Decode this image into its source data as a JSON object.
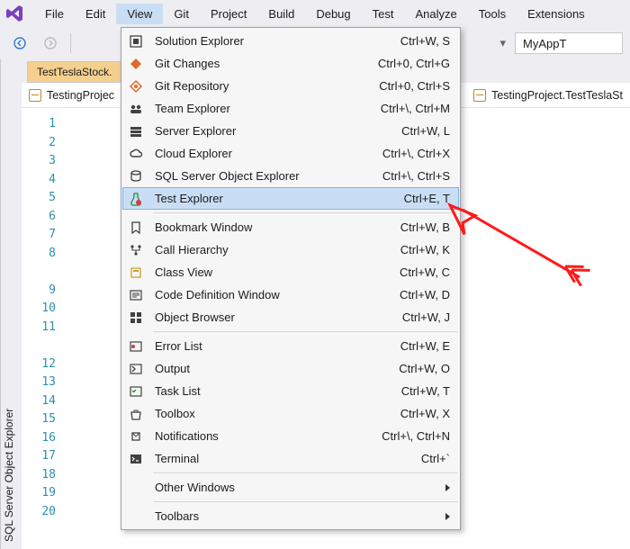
{
  "menubar": [
    "File",
    "Edit",
    "View",
    "Git",
    "Project",
    "Build",
    "Debug",
    "Test",
    "Analyze",
    "Tools",
    "Extensions"
  ],
  "menubar_active": 2,
  "toolbar": {
    "project_label": "MyAppT"
  },
  "side_tab": "SQL Server Object Explorer",
  "file_tab": "TestTeslaStock.",
  "nav_left": "TestingProjec",
  "nav_right": "TestingProject.TestTeslaSt",
  "code_fragment": "();",
  "line_groups": [
    [
      1,
      2,
      3,
      4,
      5,
      6,
      7,
      8
    ],
    [
      9,
      10,
      11
    ],
    [
      12,
      13,
      14,
      15,
      16,
      17,
      18,
      19,
      20
    ]
  ],
  "menu_sections": [
    [
      {
        "icon": "solution",
        "label": "Solution Explorer",
        "shortcut": "Ctrl+W, S"
      },
      {
        "icon": "git-changes",
        "label": "Git Changes",
        "shortcut": "Ctrl+0, Ctrl+G"
      },
      {
        "icon": "git-repo",
        "label": "Git Repository",
        "shortcut": "Ctrl+0, Ctrl+S"
      },
      {
        "icon": "team",
        "label": "Team Explorer",
        "shortcut": "Ctrl+\\, Ctrl+M"
      },
      {
        "icon": "server",
        "label": "Server Explorer",
        "shortcut": "Ctrl+W, L"
      },
      {
        "icon": "cloud",
        "label": "Cloud Explorer",
        "shortcut": "Ctrl+\\, Ctrl+X"
      },
      {
        "icon": "sql",
        "label": "SQL Server Object Explorer",
        "shortcut": "Ctrl+\\, Ctrl+S"
      },
      {
        "icon": "test",
        "label": "Test Explorer",
        "shortcut": "Ctrl+E, T",
        "highlight": true
      }
    ],
    [
      {
        "icon": "bookmark",
        "label": "Bookmark Window",
        "shortcut": "Ctrl+W, B"
      },
      {
        "icon": "call-hier",
        "label": "Call Hierarchy",
        "shortcut": "Ctrl+W, K"
      },
      {
        "icon": "class-view",
        "label": "Class View",
        "shortcut": "Ctrl+W, C"
      },
      {
        "icon": "code-def",
        "label": "Code Definition Window",
        "shortcut": "Ctrl+W, D"
      },
      {
        "icon": "obj-browser",
        "label": "Object Browser",
        "shortcut": "Ctrl+W, J"
      }
    ],
    [
      {
        "icon": "error-list",
        "label": "Error List",
        "shortcut": "Ctrl+W, E"
      },
      {
        "icon": "output",
        "label": "Output",
        "shortcut": "Ctrl+W, O"
      },
      {
        "icon": "task-list",
        "label": "Task List",
        "shortcut": "Ctrl+W, T"
      },
      {
        "icon": "toolbox",
        "label": "Toolbox",
        "shortcut": "Ctrl+W, X"
      },
      {
        "icon": "notifications",
        "label": "Notifications",
        "shortcut": "Ctrl+\\, Ctrl+N"
      },
      {
        "icon": "terminal",
        "label": "Terminal",
        "shortcut": "Ctrl+`"
      }
    ],
    [
      {
        "icon": "",
        "label": "Other Windows",
        "shortcut": "",
        "submenu": true
      }
    ],
    [
      {
        "icon": "",
        "label": "Toolbars",
        "shortcut": "",
        "submenu": true
      }
    ]
  ]
}
